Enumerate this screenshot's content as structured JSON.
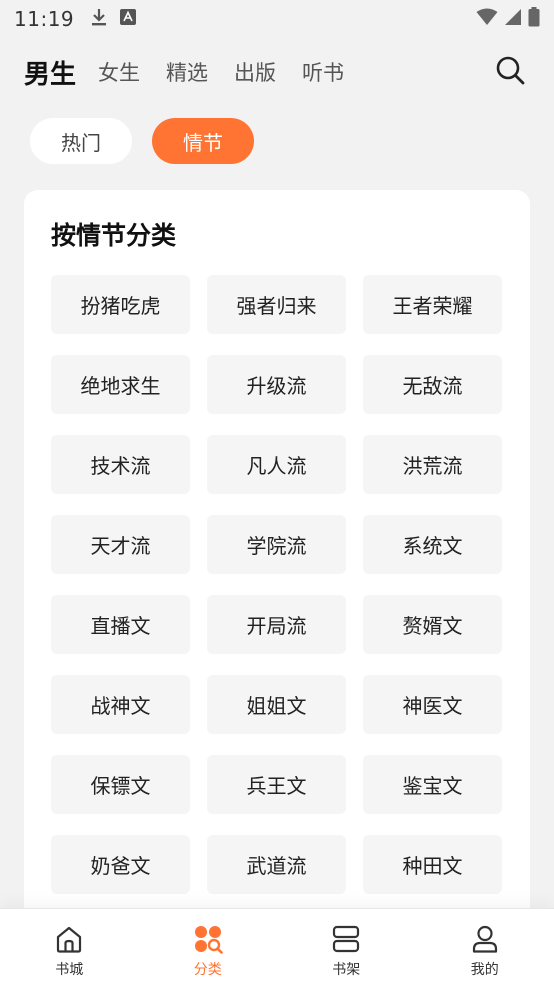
{
  "status_bar": {
    "time": "11:19",
    "icons": [
      "download-icon",
      "font-icon",
      "wifi-icon",
      "signal-icon",
      "battery-icon"
    ]
  },
  "top_nav": {
    "tabs": [
      {
        "label": "男生",
        "active": true
      },
      {
        "label": "女生",
        "active": false
      },
      {
        "label": "精选",
        "active": false
      },
      {
        "label": "出版",
        "active": false
      },
      {
        "label": "听书",
        "active": false
      }
    ],
    "search_icon": "search-icon"
  },
  "chips": [
    {
      "label": "热门",
      "active": false
    },
    {
      "label": "情节",
      "active": true
    }
  ],
  "card": {
    "title": "按情节分类",
    "tags": [
      "扮猪吃虎",
      "强者归来",
      "王者荣耀",
      "绝地求生",
      "升级流",
      "无敌流",
      "技术流",
      "凡人流",
      "洪荒流",
      "天才流",
      "学院流",
      "系统文",
      "直播文",
      "开局流",
      "赘婿文",
      "战神文",
      "姐姐文",
      "神医文",
      "保镖文",
      "兵王文",
      "鉴宝文",
      "奶爸文",
      "武道流",
      "种田文"
    ]
  },
  "bottom_nav": {
    "items": [
      {
        "label": "书城",
        "icon": "home-icon",
        "active": false
      },
      {
        "label": "分类",
        "icon": "category-icon",
        "active": true
      },
      {
        "label": "书架",
        "icon": "bookshelf-icon",
        "active": false
      },
      {
        "label": "我的",
        "icon": "profile-icon",
        "active": false
      }
    ]
  },
  "colors": {
    "accent": "#ff7433",
    "background": "#f2f2f2",
    "card": "#ffffff",
    "tag_bg": "#f5f5f5"
  }
}
